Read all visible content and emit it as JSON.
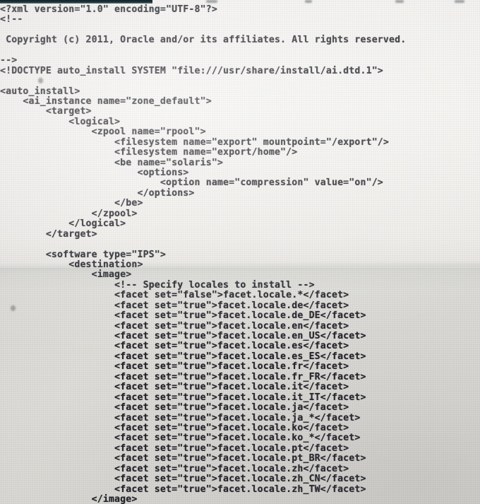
{
  "window": {
    "kind": "photographed-monitor",
    "content_type": "xml-source-listing",
    "document_name": "auto_install manifest"
  },
  "colors": {
    "background_upper": "#f2f1ee",
    "background_lower": "#dcdbd6",
    "text": "#15161c",
    "top_bar": "#1d343a"
  },
  "code": {
    "language": "xml",
    "lines": [
      "<?xml version=\"1.0\" encoding=\"UTF-8\"?>",
      "<!--",
      "",
      " Copyright (c) 2011, Oracle and/or its affiliates. All rights reserved.",
      "",
      "-->",
      "<!DOCTYPE auto_install SYSTEM \"file:///usr/share/install/ai.dtd.1\">",
      "",
      "<auto_install>",
      "    <ai_instance name=\"zone_default\">",
      "        <target>",
      "            <logical>",
      "                <zpool name=\"rpool\">",
      "                    <filesystem name=\"export\" mountpoint=\"/export\"/>",
      "                    <filesystem name=\"export/home\"/>",
      "                    <be name=\"solaris\">",
      "                        <options>",
      "                            <option name=\"compression\" value=\"on\"/>",
      "                        </options>",
      "                    </be>",
      "                </zpool>",
      "            </logical>",
      "        </target>",
      "",
      "        <software type=\"IPS\">",
      "            <destination>",
      "                <image>",
      "                    <!-- Specify locales to install -->",
      "                    <facet set=\"false\">facet.locale.*</facet>",
      "                    <facet set=\"true\">facet.locale.de</facet>",
      "                    <facet set=\"true\">facet.locale.de_DE</facet>",
      "                    <facet set=\"true\">facet.locale.en</facet>",
      "                    <facet set=\"true\">facet.locale.en_US</facet>",
      "                    <facet set=\"true\">facet.locale.es</facet>",
      "                    <facet set=\"true\">facet.locale.es_ES</facet>",
      "                    <facet set=\"true\">facet.locale.fr</facet>",
      "                    <facet set=\"true\">facet.locale.fr_FR</facet>",
      "                    <facet set=\"true\">facet.locale.it</facet>",
      "                    <facet set=\"true\">facet.locale.it_IT</facet>",
      "                    <facet set=\"true\">facet.locale.ja</facet>",
      "                    <facet set=\"true\">facet.locale.ja_*</facet>",
      "                    <facet set=\"true\">facet.locale.ko</facet>",
      "                    <facet set=\"true\">facet.locale.ko_*</facet>",
      "                    <facet set=\"true\">facet.locale.pt</facet>",
      "                    <facet set=\"true\">facet.locale.pt_BR</facet>",
      "                    <facet set=\"true\">facet.locale.zh</facet>",
      "                    <facet set=\"true\">facet.locale.zh_CN</facet>",
      "                    <facet set=\"true\">facet.locale.zh_TW</facet>",
      "                </image>"
    ]
  }
}
